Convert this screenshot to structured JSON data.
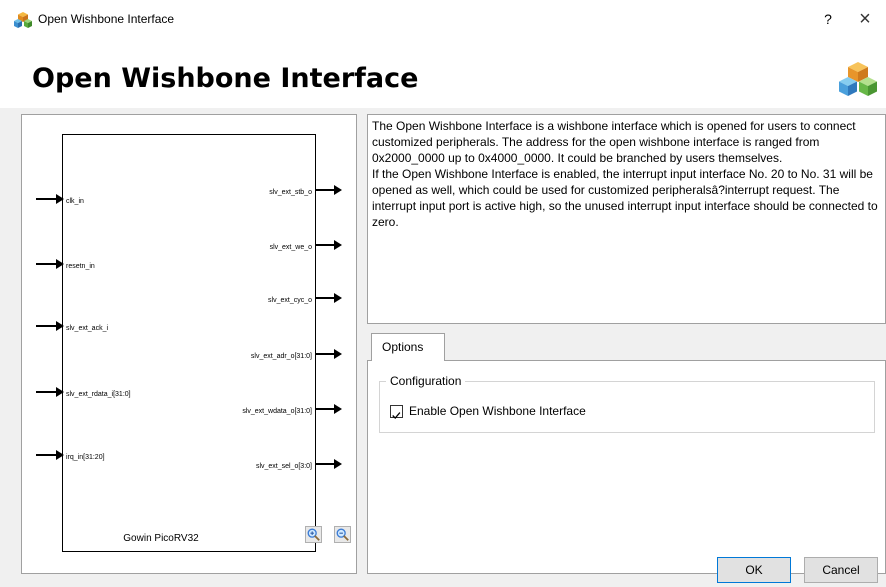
{
  "window": {
    "title": "Open Wishbone Interface",
    "help_label": "?",
    "close_label": "×"
  },
  "header": {
    "title": "Open Wishbone Interface"
  },
  "symbol": {
    "chip_name": "Gowin PicoRV32",
    "inputs": [
      "clk_in",
      "resetn_in",
      "slv_ext_ack_i",
      "slv_ext_rdata_i[31:0]",
      "irq_in[31:20]"
    ],
    "outputs": [
      "slv_ext_stb_o",
      "slv_ext_we_o",
      "slv_ext_cyc_o",
      "slv_ext_adr_o[31:0]",
      "slv_ext_wdata_o[31:0]",
      "slv_ext_sel_o[3:0]"
    ]
  },
  "description": {
    "text": "The Open Wishbone Interface is a wishbone interface which is opened for users to connect customized peripherals. The address for the open wishbone interface is ranged from 0x2000_0000 up to 0x4000_0000. It could be branched by users themselves.\nIf the Open Wishbone Interface is enabled, the interrupt input interface No. 20 to No. 31 will be opened as well, which could be used for customized peripheralsâ?interrupt request. The interrupt input port is active high, so the unused interrupt input interface should be connected to zero."
  },
  "options": {
    "tab_label": "Options",
    "group_title": "Configuration",
    "checkbox_label": "Enable Open Wishbone Interface",
    "checkbox_checked": true
  },
  "buttons": {
    "ok": "OK",
    "cancel": "Cancel"
  }
}
